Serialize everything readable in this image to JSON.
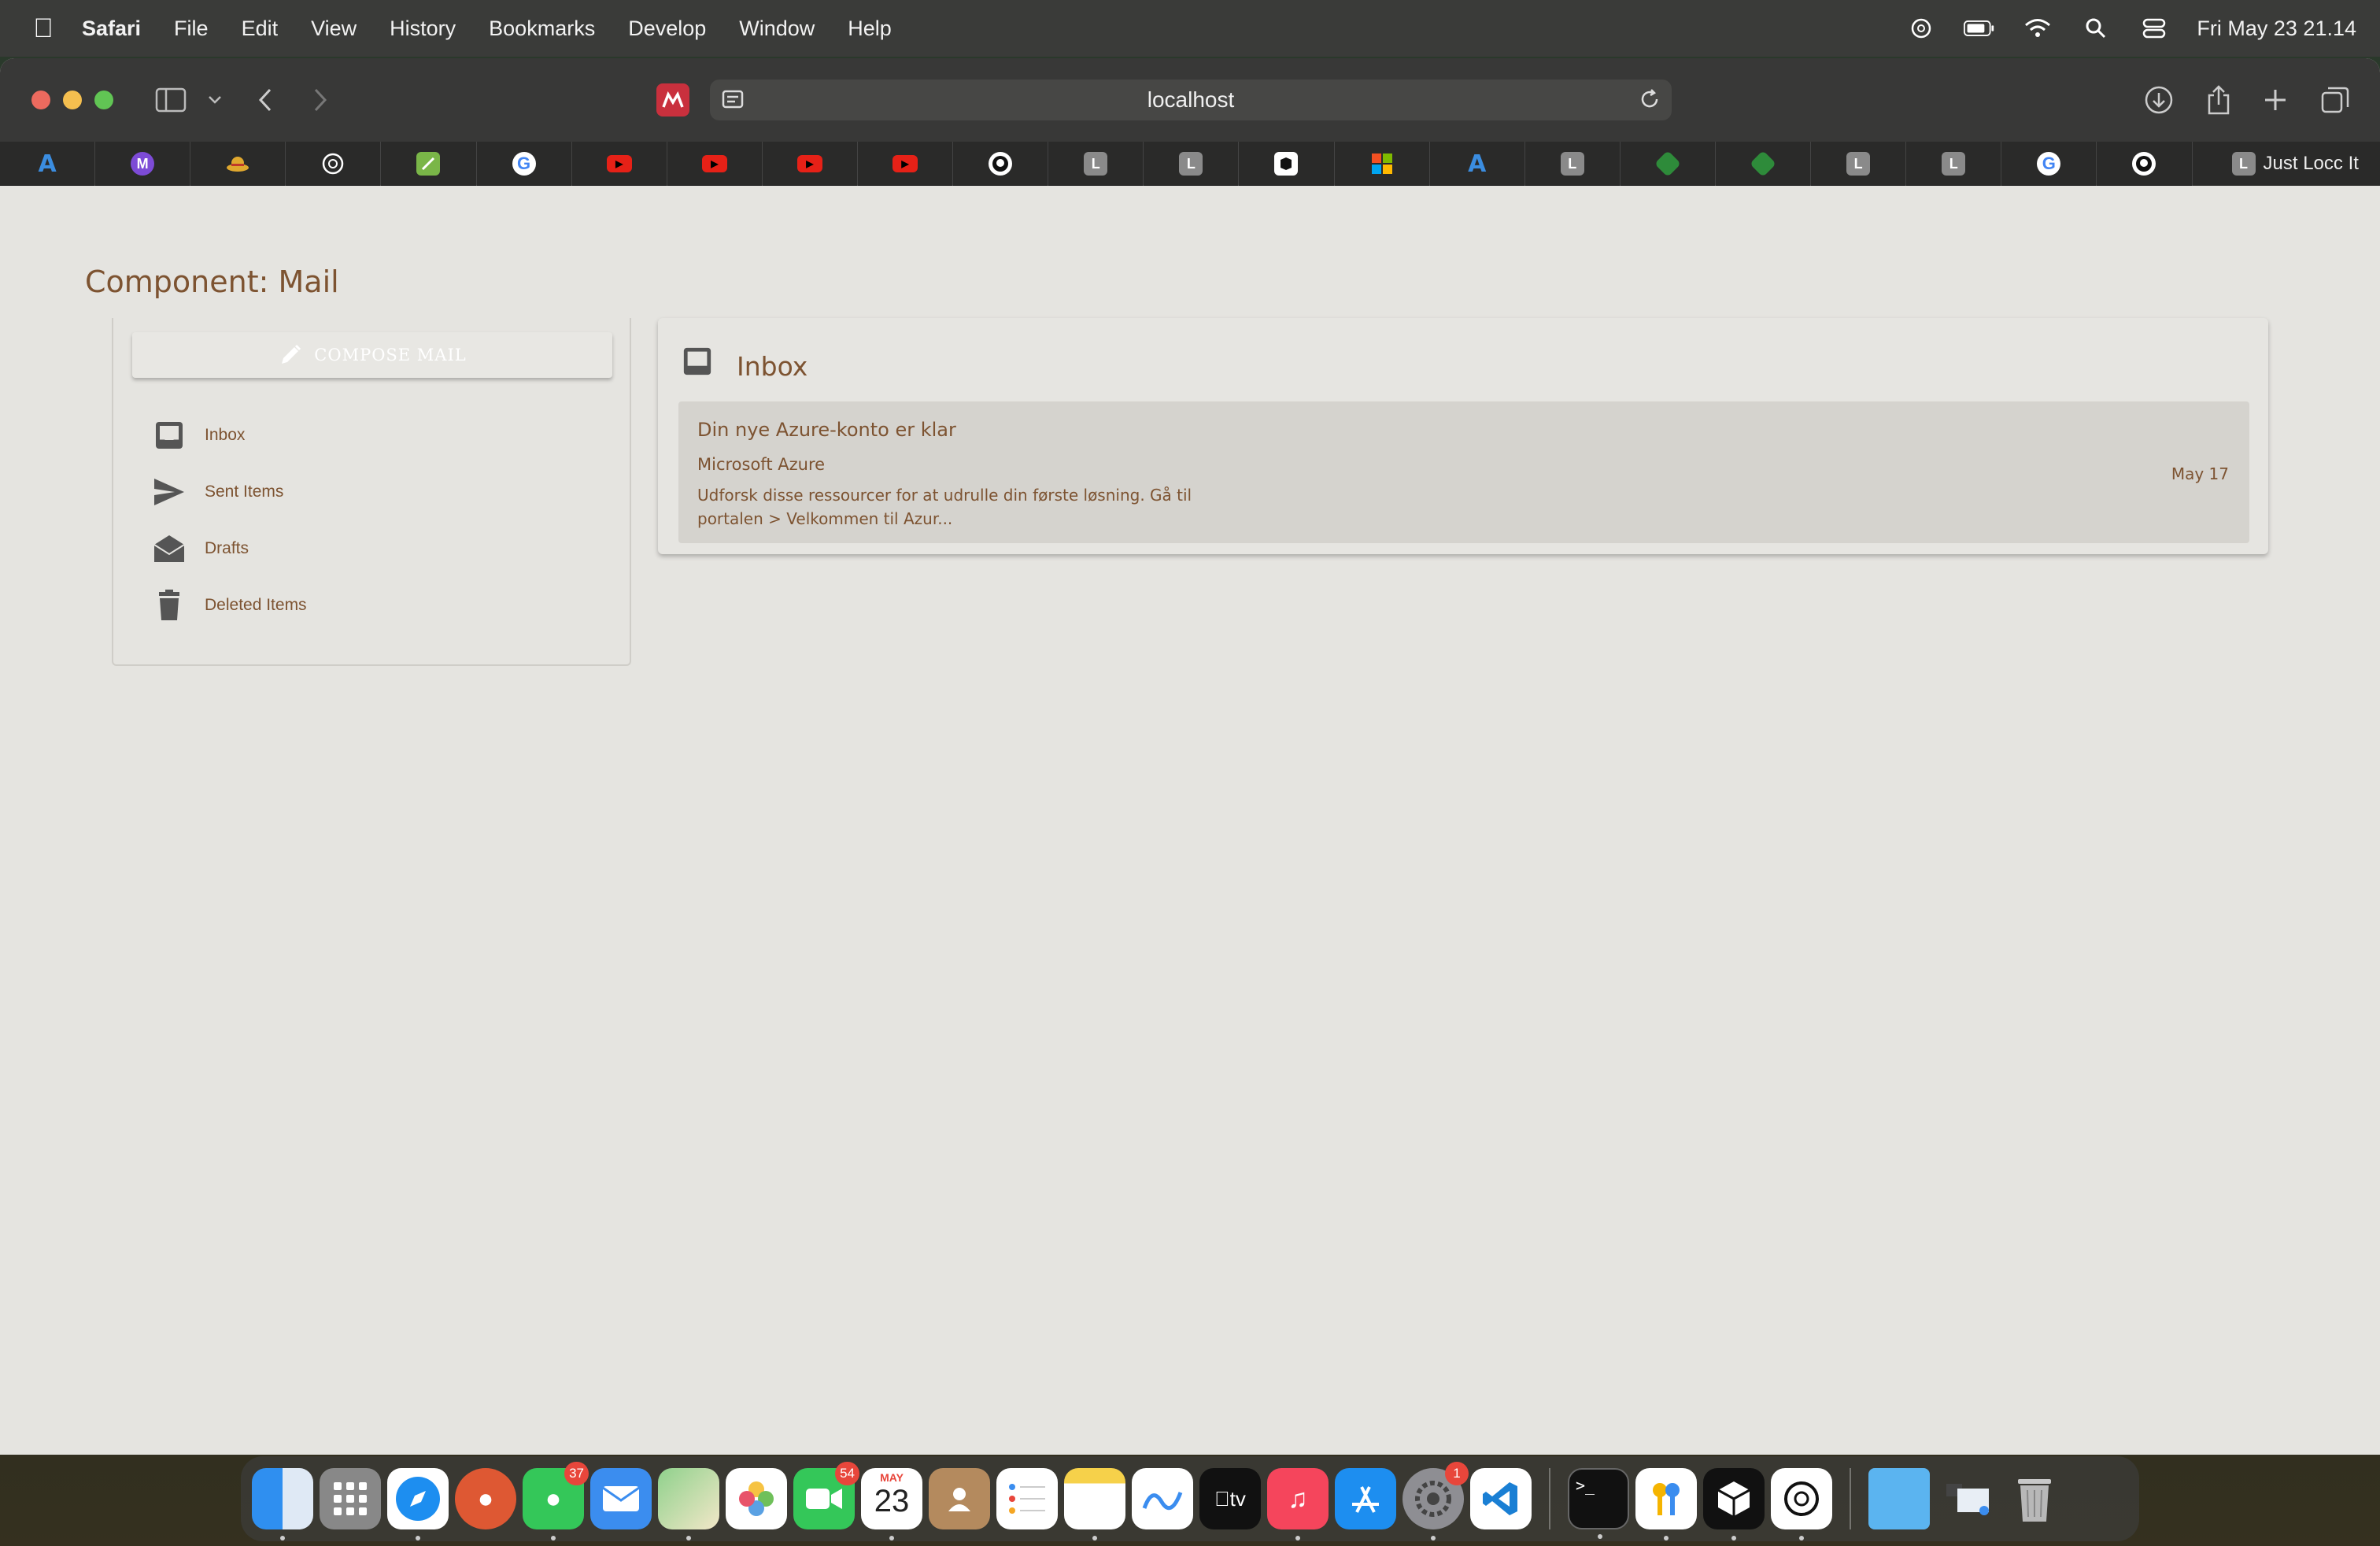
{
  "menubar": {
    "app_name": "Safari",
    "items": [
      "File",
      "Edit",
      "View",
      "History",
      "Bookmarks",
      "Develop",
      "Window",
      "Help"
    ],
    "clock": "Fri May 23  21.14"
  },
  "browser": {
    "url": "localhost",
    "active_tab_label": "Just Locc It",
    "active_tab_favicon_letter": "L",
    "tab_favicons": [
      "azure-icon",
      "m-icon",
      "hat-icon",
      "openai-icon",
      "leaf-icon",
      "google-icon",
      "youtube-icon",
      "youtube-icon",
      "youtube-icon",
      "youtube-icon",
      "github-icon",
      "L",
      "L",
      "box-icon",
      "microsoft-icon",
      "azure-icon",
      "L",
      "leaf-green-icon",
      "leaf-green-icon",
      "L",
      "L",
      "google-icon",
      "github-icon"
    ]
  },
  "page": {
    "title": "Component: Mail",
    "compose_label": "COMPOSE MAIL",
    "folders": [
      {
        "label": "Inbox",
        "icon": "inbox-icon"
      },
      {
        "label": "Sent Items",
        "icon": "send-icon"
      },
      {
        "label": "Drafts",
        "icon": "drafts-icon"
      },
      {
        "label": "Deleted Items",
        "icon": "trash-icon"
      }
    ],
    "inbox_title": "Inbox",
    "mail": {
      "subject": "Din nye Azure-konto er klar",
      "from": "Microsoft Azure",
      "preview": "Udforsk disse ressourcer for at udrulle din første løsning.  Gå til portalen > Velkommen til Azur...",
      "date": "May 17"
    }
  },
  "dock": {
    "messages_badge": "37",
    "facetime_badge": "54",
    "calendar_month": "MAY",
    "calendar_day": "23",
    "settings_badge": "1",
    "appletv_label": "tv"
  },
  "colors": {
    "accent_brown": "#7d5331",
    "page_bg": "#e5e4e0",
    "mail_row_bg": "#d5d3ce"
  }
}
